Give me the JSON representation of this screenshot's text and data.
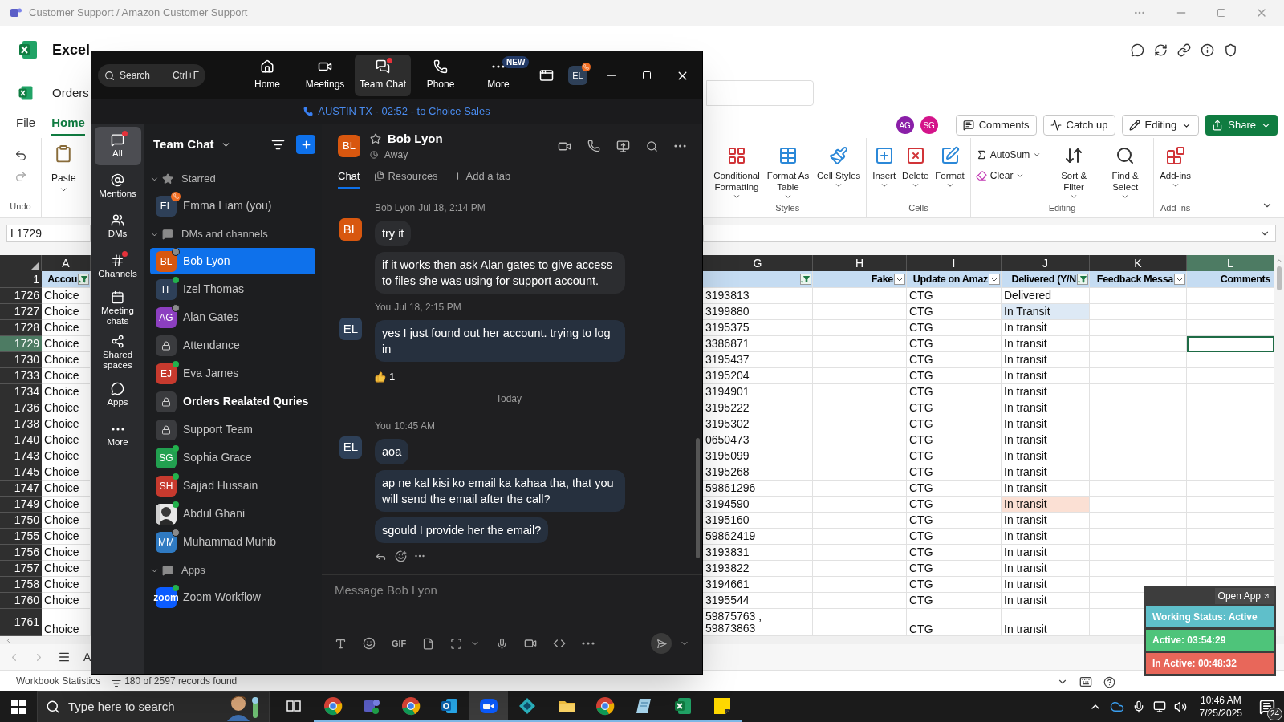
{
  "window": {
    "title": "Customer Support / Amazon Customer Support"
  },
  "excel": {
    "app_name": "Excel",
    "file_name": "Orders",
    "ribbon_tabs": [
      {
        "label": "File",
        "selected": false
      },
      {
        "label": "Home",
        "selected": true
      }
    ],
    "collaborators": [
      {
        "initials": "AG",
        "color": "#8a1fa8"
      },
      {
        "initials": "SG",
        "color": "#d4148a"
      }
    ],
    "header_buttons": [
      {
        "label": "Comments",
        "kind": "outline"
      },
      {
        "label": "Catch up",
        "kind": "outline"
      },
      {
        "label": "Editing",
        "kind": "dropdown"
      },
      {
        "label": "Share",
        "kind": "primary"
      }
    ],
    "undo_group_label": "Undo",
    "paste_label": "Paste",
    "ribbon_groups": [
      {
        "name": "Styles",
        "commands": [
          {
            "label": "Conditional Formatting",
            "kind": "large"
          },
          {
            "label": "Format As Table",
            "kind": "large"
          },
          {
            "label": "Cell Styles",
            "kind": "large"
          }
        ]
      },
      {
        "name": "Cells",
        "commands": [
          {
            "label": "Insert",
            "kind": "large"
          },
          {
            "label": "Delete",
            "kind": "large"
          },
          {
            "label": "Format",
            "kind": "large"
          }
        ]
      },
      {
        "name": "Editing",
        "commands": [
          {
            "label": "AutoSum",
            "kind": "small"
          },
          {
            "label": "Clear",
            "kind": "small"
          },
          {
            "label": "Sort & Filter",
            "kind": "large"
          },
          {
            "label": "Find & Select",
            "kind": "large"
          }
        ]
      },
      {
        "name": "Add-ins",
        "commands": [
          {
            "label": "Add-ins",
            "kind": "large"
          }
        ]
      }
    ],
    "name_box": "L1729",
    "header_row_number": "1",
    "columns": [
      {
        "letter": "A",
        "header": "Accou",
        "filter_button": true,
        "filtered": true,
        "selected": false
      },
      {
        "letter": "G",
        "filter_button": true,
        "filtered": true,
        "selected": false
      },
      {
        "letter": "H",
        "header": "Fake",
        "filter_button": true,
        "filtered": false,
        "selected": false
      },
      {
        "letter": "I",
        "header": "Update on Amaz",
        "filter_button": true,
        "filtered": false,
        "selected": false
      },
      {
        "letter": "J",
        "header": "Delivered (Y/N",
        "filter_button": true,
        "filtered": true,
        "selected": false
      },
      {
        "letter": "K",
        "header": "Feedback Messa",
        "filter_button": true,
        "filtered": false,
        "selected": false
      },
      {
        "letter": "L",
        "header": "Comments",
        "filter_button": false,
        "selected": true
      }
    ],
    "rows": [
      {
        "number": "1726",
        "selected": false,
        "a": "Choice",
        "g": [
          "3193813"
        ],
        "i": "CTG",
        "j": {
          "text": "Delivered"
        }
      },
      {
        "number": "1727",
        "selected": false,
        "a": "Choice",
        "g": [
          "3199880"
        ],
        "i": "CTG",
        "j": {
          "text": "In Transit",
          "color": "#dde9f5"
        }
      },
      {
        "number": "1728",
        "selected": false,
        "a": "Choice",
        "g": [
          "3195375"
        ],
        "i": "CTG",
        "j": {
          "text": "In transit"
        }
      },
      {
        "number": "1729",
        "selected": true,
        "a": "Choice",
        "g": [
          "3386871"
        ],
        "i": "CTG",
        "j": {
          "text": "In transit"
        }
      },
      {
        "number": "1730",
        "selected": false,
        "a": "Choice",
        "g": [
          "3195437"
        ],
        "i": "CTG",
        "j": {
          "text": "In transit"
        }
      },
      {
        "number": "1733",
        "selected": false,
        "a": "Choice",
        "g": [
          "3195204"
        ],
        "i": "CTG",
        "j": {
          "text": "In transit"
        }
      },
      {
        "number": "1734",
        "selected": false,
        "a": "Choice",
        "g": [
          "3194901"
        ],
        "i": "CTG",
        "j": {
          "text": "In transit"
        }
      },
      {
        "number": "1736",
        "selected": false,
        "a": "Choice",
        "g": [
          "3195222"
        ],
        "i": "CTG",
        "j": {
          "text": "In transit"
        }
      },
      {
        "number": "1738",
        "selected": false,
        "a": "Choice",
        "g": [
          "3195302"
        ],
        "i": "CTG",
        "j": {
          "text": "In transit"
        }
      },
      {
        "number": "1740",
        "selected": false,
        "a": "Choice",
        "g": [
          "0650473"
        ],
        "i": "CTG",
        "j": {
          "text": "In transit"
        }
      },
      {
        "number": "1743",
        "selected": false,
        "a": "Choice",
        "g": [
          "3195099"
        ],
        "i": "CTG",
        "j": {
          "text": "In transit"
        }
      },
      {
        "number": "1745",
        "selected": false,
        "a": "Choice",
        "g": [
          "3195268"
        ],
        "i": "CTG",
        "j": {
          "text": "In transit"
        }
      },
      {
        "number": "1747",
        "selected": false,
        "a": "Choice",
        "g": [
          "59861296"
        ],
        "i": "CTG",
        "j": {
          "text": "In transit"
        }
      },
      {
        "number": "1749",
        "selected": false,
        "a": "Choice",
        "g": [
          "3194590"
        ],
        "i": "CTG",
        "j": {
          "text": "In transit",
          "color": "#fbe0d4"
        }
      },
      {
        "number": "1750",
        "selected": false,
        "a": "Choice",
        "g": [
          "3195160"
        ],
        "i": "CTG",
        "j": {
          "text": "In transit"
        }
      },
      {
        "number": "1755",
        "selected": false,
        "a": "Choice",
        "g": [
          "59862419"
        ],
        "i": "CTG",
        "j": {
          "text": "In transit"
        }
      },
      {
        "number": "1756",
        "selected": false,
        "a": "Choice",
        "g": [
          "3193831"
        ],
        "i": "CTG",
        "j": {
          "text": "In transit"
        }
      },
      {
        "number": "1757",
        "selected": false,
        "a": "Choice",
        "g": [
          "3193822"
        ],
        "i": "CTG",
        "j": {
          "text": "In transit"
        }
      },
      {
        "number": "1758",
        "selected": false,
        "a": "Choice",
        "g": [
          "3194661"
        ],
        "i": "CTG",
        "j": {
          "text": "In transit"
        }
      },
      {
        "number": "1760",
        "selected": false,
        "a": "Choice",
        "g": [
          "3195544"
        ],
        "i": "CTG",
        "j": {
          "text": "In transit"
        }
      },
      {
        "number": "1761",
        "selected": false,
        "a": "Choice",
        "g": [
          "59875763 ,",
          "59873863"
        ],
        "i": "CTG",
        "j": {
          "text": "In transit"
        }
      }
    ],
    "sheet_tabs": [
      {
        "label": "A"
      }
    ],
    "status": {
      "left": "Workbook Statistics",
      "filter_summary": "180 of 2597 records found"
    }
  },
  "zoom": {
    "search": {
      "placeholder": "Search",
      "shortcut": "Ctrl+F"
    },
    "nav": [
      {
        "label": "Home",
        "selected": false,
        "dot": false
      },
      {
        "label": "Meetings",
        "selected": false,
        "dot": false
      },
      {
        "label": "Team Chat",
        "selected": true,
        "dot": true
      },
      {
        "label": "Phone",
        "selected": false,
        "dot": false
      },
      {
        "label": "More",
        "selected": false,
        "badge": "NEW"
      }
    ],
    "user_initials": "EL",
    "call_banner": "AUSTIN TX - 02:52 - to Choice Sales",
    "rail": [
      {
        "label": "All",
        "selected": true,
        "dot": true
      },
      {
        "label": "Mentions",
        "selected": false,
        "dot": false
      },
      {
        "label": "DMs",
        "selected": false,
        "dot": false
      },
      {
        "label": "Channels",
        "selected": false,
        "dot": true
      },
      {
        "label": "Meeting chats",
        "selected": false,
        "dot": false
      },
      {
        "label": "Shared spaces",
        "selected": false,
        "dot": false
      },
      {
        "label": "Apps",
        "selected": false,
        "dot": false
      },
      {
        "label": "More",
        "selected": false,
        "dot": false
      }
    ],
    "sidebar": {
      "title": "Team Chat",
      "sections": [
        {
          "title": "Starred",
          "expanded": true,
          "items": [
            {
              "name": "Emma Liam (you)",
              "kind": "person",
              "initials": "EL",
              "color": "#2e4058",
              "online": false,
              "away": false,
              "on_call": true,
              "selected": false,
              "unread": false
            }
          ]
        },
        {
          "title": "DMs and channels",
          "expanded": true,
          "items": [
            {
              "name": "Bob Lyon",
              "kind": "person",
              "initials": "BL",
              "color": "#d8570f",
              "online": false,
              "away": true,
              "on_call": false,
              "selected": true,
              "unread": false
            },
            {
              "name": "Izel Thomas",
              "kind": "person",
              "initials": "IT",
              "color": "#2e4058",
              "online": true,
              "away": false,
              "on_call": false,
              "selected": false,
              "unread": false
            },
            {
              "name": "Alan Gates",
              "kind": "person",
              "initials": "AG",
              "color": "#8c3fc0",
              "online": false,
              "away": true,
              "on_call": false,
              "selected": false,
              "unread": false
            },
            {
              "name": "Attendance",
              "kind": "channel",
              "online": false,
              "away": false,
              "on_call": false,
              "selected": false,
              "unread": false
            },
            {
              "name": "Eva James",
              "kind": "person",
              "initials": "EJ",
              "color": "#c73a2e",
              "online": true,
              "away": false,
              "on_call": false,
              "selected": false,
              "unread": false
            },
            {
              "name": "Orders Realated Quries",
              "kind": "channel",
              "online": false,
              "away": false,
              "on_call": false,
              "selected": false,
              "unread": true
            },
            {
              "name": "Support Team",
              "kind": "channel",
              "online": false,
              "away": false,
              "on_call": false,
              "selected": false,
              "unread": false
            },
            {
              "name": "Sophia Grace",
              "kind": "person",
              "initials": "SG",
              "color": "#22a050",
              "online": true,
              "away": false,
              "on_call": false,
              "selected": false,
              "unread": false
            },
            {
              "name": "Sajjad Hussain",
              "kind": "person",
              "initials": "SH",
              "color": "#c73a2e",
              "online": true,
              "away": false,
              "on_call": false,
              "selected": false,
              "unread": false
            },
            {
              "name": "Abdul Ghani",
              "online": true,
              "away": false,
              "on_call": false,
              "selected": false,
              "unread": false
            },
            {
              "name": "Muhammad Muhib",
              "kind": "person",
              "initials": "MM",
              "color": "#2f7ac2",
              "online": false,
              "away": true,
              "on_call": false,
              "selected": false,
              "unread": false
            }
          ]
        },
        {
          "title": "Apps",
          "expanded": true,
          "items": [
            {
              "name": "Zoom Workflow",
              "kind": "app",
              "initials": "zoom",
              "color": "#0b5cff",
              "online": true,
              "away": false,
              "on_call": false,
              "selected": false,
              "unread": false
            }
          ]
        }
      ]
    },
    "chat": {
      "name": "Bob Lyon",
      "initials": "BL",
      "color": "#d8570f",
      "presence": "Away",
      "tabs": [
        {
          "label": "Chat",
          "selected": true
        },
        {
          "label": "Resources",
          "selected": false
        },
        {
          "label": "Add a tab",
          "selected": false
        }
      ],
      "messages": [
        {
          "kind": "group",
          "sender": "Bob Lyon",
          "time": "Jul 18, 2:14 PM",
          "initials": "BL",
          "color": "#d8570f",
          "mine": false,
          "bubbles": [
            "try it",
            "if it works then ask Alan gates to give access to files she was using for support account."
          ]
        },
        {
          "kind": "group",
          "sender": "You",
          "time": "Jul 18, 2:15 PM",
          "initials": "EL",
          "color": "#2e4058",
          "mine": true,
          "bubbles": [
            "yes I just found out her account. trying to log in"
          ],
          "reactions": [
            {
              "kind": "thumbs_up",
              "count": "1"
            }
          ]
        },
        {
          "kind": "divider",
          "label": "Today"
        },
        {
          "kind": "group",
          "sender": "You",
          "time": "10:45 AM",
          "initials": "EL",
          "color": "#2e4058",
          "mine": true,
          "bubbles": [
            "aoa",
            "ap ne kal kisi ko email ka kahaa tha, that you will send the email after the call?",
            "sgould I provide her the email?"
          ],
          "hover_actions": true
        }
      ],
      "composer": {
        "placeholder": "Message Bob Lyon",
        "gif_label": "GIF"
      }
    }
  },
  "status_widget": {
    "open_app": "Open App",
    "rows": [
      {
        "label": "Working Status: Active",
        "color": "#5fbfca"
      },
      {
        "label": "Active: 03:54:29",
        "color": "#4ec47a"
      },
      {
        "label": "In Active: 00:48:32",
        "color": "#e8675a"
      }
    ]
  },
  "taskbar": {
    "search_placeholder": "Type here to search",
    "apps": [
      {
        "kind": "task_view",
        "running": false,
        "selected": false
      },
      {
        "kind": "chrome",
        "running": true,
        "selected": false
      },
      {
        "kind": "teams",
        "running": true,
        "selected": false
      },
      {
        "kind": "chrome",
        "running": true,
        "selected": false
      },
      {
        "kind": "outlook",
        "running": true,
        "selected": false
      },
      {
        "kind": "zoom",
        "running": true,
        "selected": true
      },
      {
        "kind": "diamond",
        "running": true,
        "selected": false
      },
      {
        "kind": "folder",
        "running": true,
        "selected": false
      },
      {
        "kind": "chrome",
        "running": true,
        "selected": false
      },
      {
        "kind": "notepad",
        "running": true,
        "selected": false
      },
      {
        "kind": "excel",
        "running": true,
        "selected": false
      },
      {
        "kind": "sticky",
        "running": true,
        "selected": false
      }
    ],
    "time": "10:46 AM",
    "date": "7/25/2025",
    "notifications": "24"
  }
}
